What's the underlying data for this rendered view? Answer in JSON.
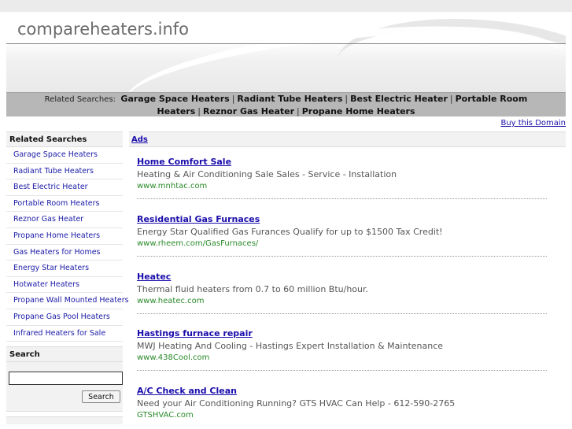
{
  "site": {
    "title": "compareheaters.info"
  },
  "related_bar": {
    "label": "Related Searches:",
    "items": [
      "Garage Space Heaters",
      "Radiant Tube Heaters",
      "Best Electric Heater",
      "Portable Room Heaters",
      "Reznor Gas Heater",
      "Propane Home Heaters"
    ],
    "separator": "|"
  },
  "buy_domain": "Buy this Domain",
  "sidebar": {
    "heading": "Related Searches",
    "items": [
      "Garage Space Heaters",
      "Radiant Tube Heaters",
      "Best Electric Heater",
      "Portable Room Heaters",
      "Reznor Gas Heater",
      "Propane Home Heaters",
      "Gas Heaters for Homes",
      "Energy Star Heaters",
      "Hotwater Heaters",
      "Propane Wall Mounted Heaters",
      "Propane Gas Pool Heaters",
      "Infrared Heaters for Sale"
    ],
    "search_heading": "Search",
    "search_value": "",
    "search_button": "Search"
  },
  "main": {
    "ads_label": "Ads",
    "ads": [
      {
        "title": "Home Comfort Sale",
        "desc": "Heating & Air Conditioning Sale Sales - Service - Installation",
        "url": "www.mnhtac.com"
      },
      {
        "title": "Residential Gas Furnaces",
        "desc": "Energy Star Qualified Gas Furances Qualify for up to $1500 Tax Credit!",
        "url": "www.rheem.com/GasFurnaces/"
      },
      {
        "title": "Heatec",
        "desc": "Thermal fluid heaters from 0.7 to 60 million Btu/hour.",
        "url": "www.heatec.com"
      },
      {
        "title": "Hastings furnace repair",
        "desc": "MWJ Heating And Cooling - Hastings Expert Installation & Maintenance",
        "url": "www.438Cool.com"
      },
      {
        "title": "A/C Check and Clean",
        "desc": "Need your Air Conditioning Running? GTS HVAC Can Help - 612-590-2765",
        "url": "GTSHVAC.com"
      }
    ]
  }
}
